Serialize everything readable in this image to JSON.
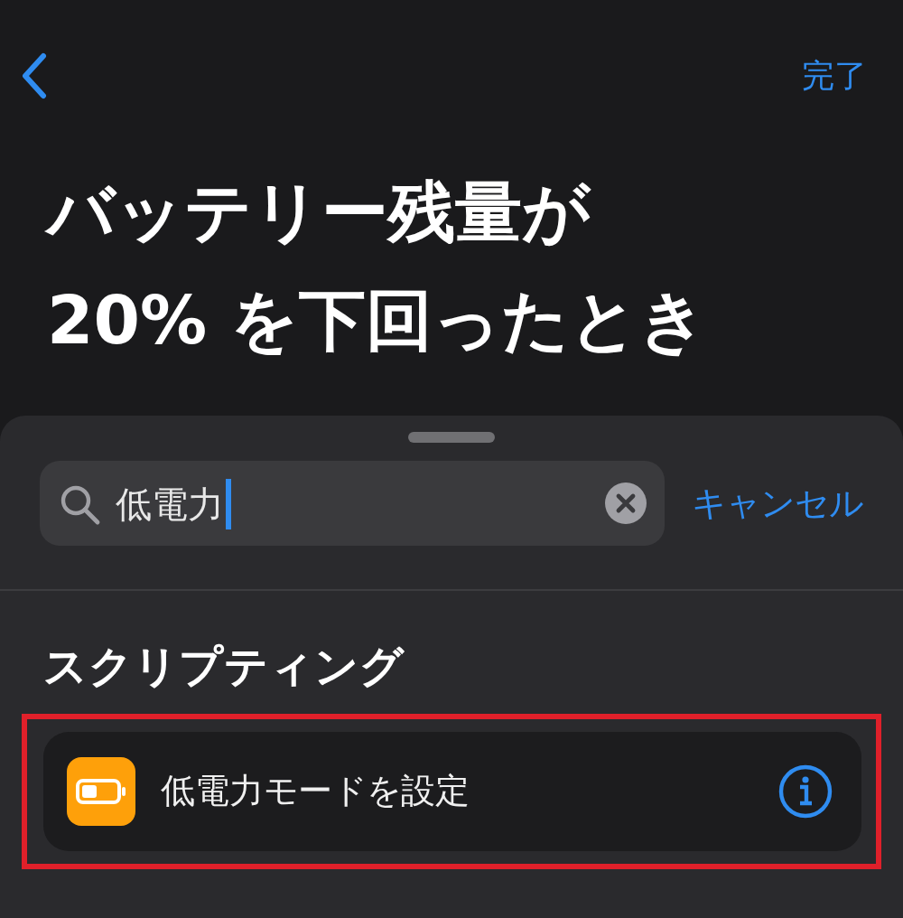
{
  "nav": {
    "done": "完了"
  },
  "title": [
    "バッテリー残量が",
    "20% を下回ったとき"
  ],
  "search": {
    "value": "低電力",
    "cancel": "キャンセル"
  },
  "section": "スクリプティング",
  "results": [
    {
      "label": "低電力モードを設定",
      "highlighted": true
    }
  ]
}
